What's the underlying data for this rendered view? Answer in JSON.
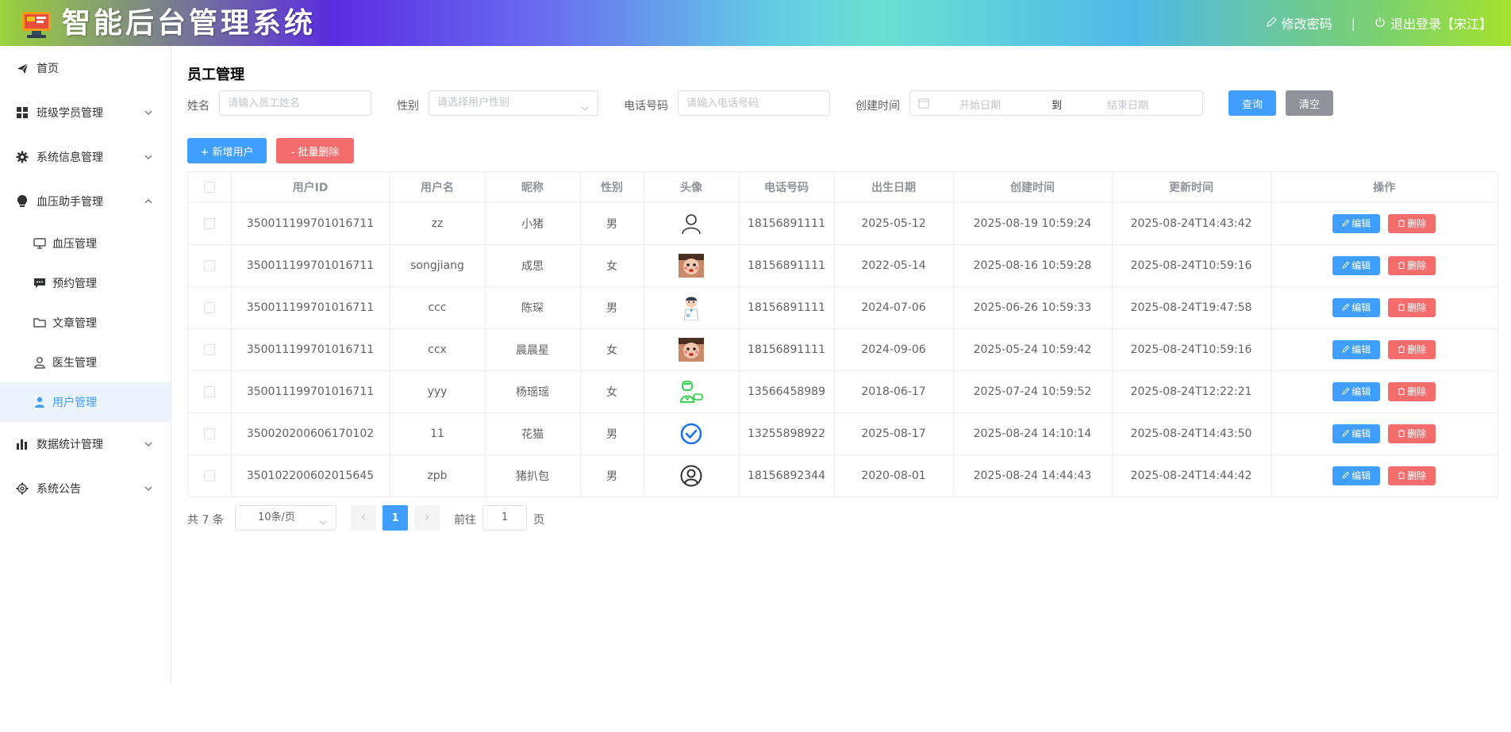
{
  "header": {
    "title": "智能后台管理系统",
    "change_password": "修改密码",
    "separator": "|",
    "logout": "退出登录【宋江】"
  },
  "sidebar": {
    "items": [
      {
        "label": "首页",
        "icon": "paper-plane-icon"
      },
      {
        "label": "班级学员管理",
        "icon": "grid-icon",
        "expandable": true
      },
      {
        "label": "系统信息管理",
        "icon": "gear-icon",
        "expandable": true
      },
      {
        "label": "血压助手管理",
        "icon": "lightbulb-icon",
        "expandable": true,
        "expanded": true
      },
      {
        "label": "数据统计管理",
        "icon": "bar-chart-icon",
        "expandable": true
      },
      {
        "label": "系统公告",
        "icon": "settings-icon",
        "expandable": true
      }
    ],
    "sub_items": [
      {
        "label": "血压管理",
        "icon": "monitor-icon"
      },
      {
        "label": "预约管理",
        "icon": "chat-icon"
      },
      {
        "label": "文章管理",
        "icon": "folder-icon"
      },
      {
        "label": "医生管理",
        "icon": "user-outline-icon"
      },
      {
        "label": "用户管理",
        "icon": "user-filled-icon",
        "active": true
      }
    ]
  },
  "main": {
    "title": "员工管理",
    "filters": {
      "name_label": "姓名",
      "name_placeholder": "请输入员工姓名",
      "gender_label": "性别",
      "gender_placeholder": "请选择用户性别",
      "phone_label": "电话号码",
      "phone_placeholder": "请输入电话号码",
      "created_label": "创建时间",
      "start_placeholder": "开始日期",
      "range_sep": "到",
      "end_placeholder": "结束日期",
      "query_btn": "查询",
      "clear_btn": "清空"
    },
    "actions": {
      "add_btn": "+ 新增用户",
      "batch_delete_btn": "- 批量删除"
    },
    "table": {
      "columns": [
        "用户ID",
        "用户名",
        "昵称",
        "性别",
        "头像",
        "电话号码",
        "出生日期",
        "创建时间",
        "更新时间",
        "操作"
      ],
      "rows": [
        {
          "id": "350011199701016711",
          "username": "zz",
          "nickname": "小猪",
          "gender": "男",
          "avatar": "user-outline-avatar",
          "phone": "18156891111",
          "birth": "2025-05-12",
          "created": "2025-08-19 10:59:24",
          "updated": "2025-08-24T14:43:42"
        },
        {
          "id": "350011199701016711",
          "username": "songjiang",
          "nickname": "成思",
          "gender": "女",
          "avatar": "baby-photo-avatar",
          "phone": "18156891111",
          "birth": "2022-05-14",
          "created": "2025-08-16 10:59:28",
          "updated": "2025-08-24T10:59:16"
        },
        {
          "id": "350011199701016711",
          "username": "ccc",
          "nickname": "陈琛",
          "gender": "男",
          "avatar": "doctor-avatar",
          "phone": "18156891111",
          "birth": "2024-07-06",
          "created": "2025-06-26 10:59:33",
          "updated": "2025-08-24T19:47:58"
        },
        {
          "id": "350011199701016711",
          "username": "ccx",
          "nickname": "晨晨星",
          "gender": "女",
          "avatar": "baby-photo-avatar",
          "phone": "18156891111",
          "birth": "2024-09-06",
          "created": "2025-05-24 10:59:42",
          "updated": "2025-08-24T10:59:16"
        },
        {
          "id": "350011199701016711",
          "username": "yyy",
          "nickname": "杨瑶瑶",
          "gender": "女",
          "avatar": "green-doctor-avatar",
          "phone": "13566458989",
          "birth": "2018-06-17",
          "created": "2025-07-24 10:59:52",
          "updated": "2025-08-24T12:22:21"
        },
        {
          "id": "350020200606170102",
          "username": "11",
          "nickname": "花猫",
          "gender": "男",
          "avatar": "blue-check-avatar",
          "phone": "13255898922",
          "birth": "2025-08-17",
          "created": "2025-08-24 14:10:14",
          "updated": "2025-08-24T14:43:50"
        },
        {
          "id": "350102200602015645",
          "username": "zpb",
          "nickname": "猪扒包",
          "gender": "男",
          "avatar": "user-circle-avatar",
          "phone": "18156892344",
          "birth": "2020-08-01",
          "created": "2025-08-24 14:44:43",
          "updated": "2025-08-24T14:44:42"
        }
      ],
      "edit_label": "编辑",
      "delete_label": "删除"
    },
    "pagination": {
      "total": "共 7 条",
      "page_size": "10条/页",
      "current_page": "1",
      "goto_label": "前往",
      "goto_value": "1",
      "page_suffix": "页"
    }
  },
  "colors": {
    "primary": "#409eff",
    "danger": "#f56c6c",
    "gray": "#909399",
    "active_bg": "#ecf5ff"
  }
}
